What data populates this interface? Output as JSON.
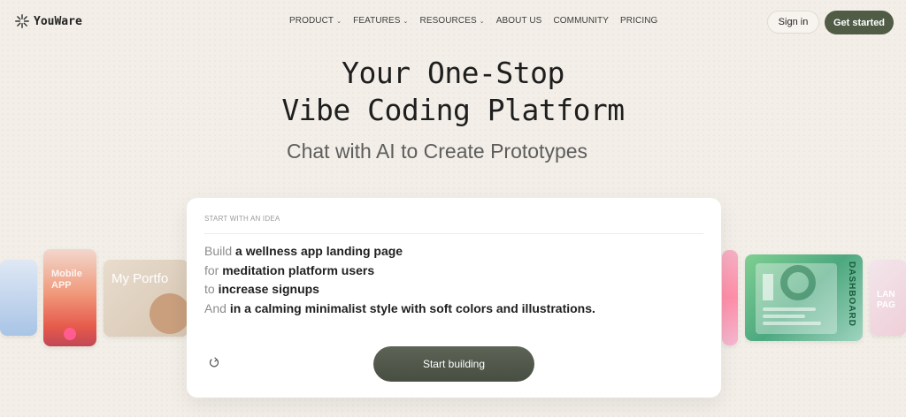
{
  "brand": {
    "name": "YouWare",
    "icon": "sparkle-logo-icon"
  },
  "nav": {
    "items": [
      {
        "label": "PRODUCT",
        "has_dropdown": true
      },
      {
        "label": "FEATURES",
        "has_dropdown": true
      },
      {
        "label": "RESOURCES",
        "has_dropdown": true
      },
      {
        "label": "ABOUT US",
        "has_dropdown": false
      },
      {
        "label": "COMMUNITY",
        "has_dropdown": false
      },
      {
        "label": "PRICING",
        "has_dropdown": false
      }
    ],
    "sign_in": "Sign in",
    "get_started": "Get started"
  },
  "hero": {
    "title_line1": "Your One-Stop",
    "title_line2": "Vibe Coding Platform",
    "subtitle": "Chat with AI to Create Prototypes"
  },
  "carousel": {
    "mobile_label_line1": "Mobile",
    "mobile_label_line2": "APP",
    "portfolio_label": "My Portfo",
    "dashboard_label": "DASHBOARD",
    "landing_label_line1": "LAN",
    "landing_label_line2": "PAG"
  },
  "prompt": {
    "header": "START WITH AN IDEA",
    "lines": [
      {
        "lead": "Build",
        "text": "a wellness app landing page"
      },
      {
        "lead": "for",
        "text": "meditation platform users"
      },
      {
        "lead": "to",
        "text": "increase signups"
      },
      {
        "lead": "And",
        "text": "in a calming minimalist style with soft colors and illustrations."
      }
    ],
    "shuffle_icon": "shuffle-icon",
    "button": "Start building"
  },
  "colors": {
    "background": "#f3efe8",
    "primary_button": "#515c47",
    "text_dark": "#1f1f1f",
    "text_muted": "#8c8c8c"
  }
}
